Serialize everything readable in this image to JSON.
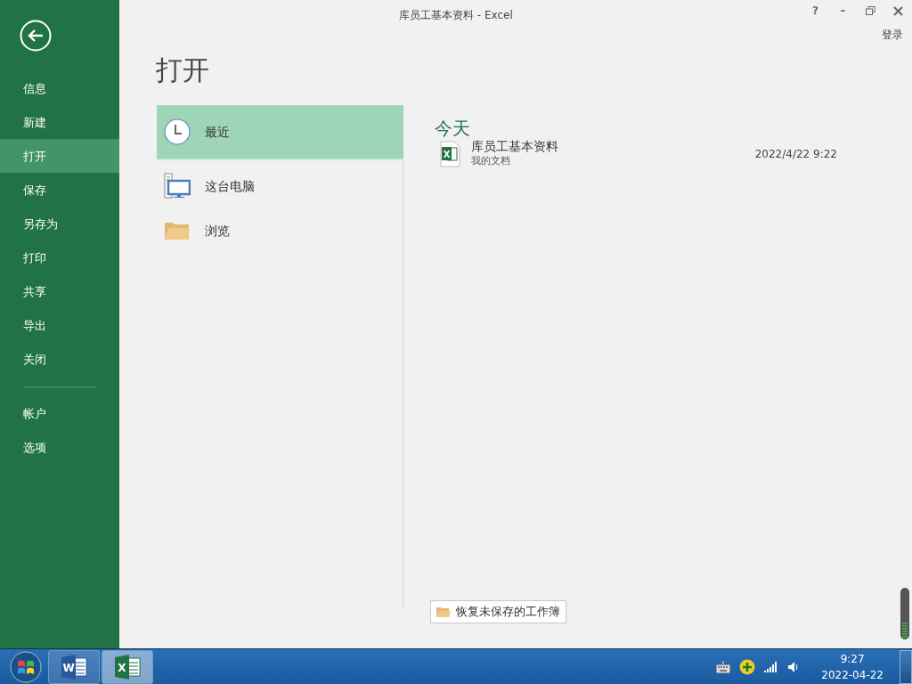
{
  "window": {
    "title": "库员工基本资料 - Excel",
    "controls": [
      "?",
      "–"
    ],
    "sign_in": "登录"
  },
  "sidebar": {
    "groups": [
      [
        {
          "label": "信息",
          "selected": false
        },
        {
          "label": "新建",
          "selected": false
        },
        {
          "label": "打开",
          "selected": true
        },
        {
          "label": "保存",
          "selected": false
        },
        {
          "label": "另存为",
          "selected": false
        },
        {
          "label": "打印",
          "selected": false
        },
        {
          "label": "共享",
          "selected": false
        },
        {
          "label": "导出",
          "selected": false
        },
        {
          "label": "关闭",
          "selected": false
        }
      ],
      [
        {
          "label": "帐户",
          "selected": false
        },
        {
          "label": "选项",
          "selected": false
        }
      ]
    ]
  },
  "page_title": "打开",
  "places": [
    {
      "kind": "recent",
      "label": "最近",
      "selected": true
    },
    {
      "kind": "computer",
      "label": "这台电脑",
      "selected": false
    },
    {
      "kind": "browse",
      "label": "浏览",
      "selected": false
    }
  ],
  "recent": {
    "group": "今天",
    "files": [
      {
        "name": "库员工基本资料",
        "location": "我的文档",
        "date": "2022/4/22 9:22",
        "icon_letter": "X"
      }
    ]
  },
  "recover_button": "恢复未保存的工作簿",
  "taskbar": {
    "apps": [
      {
        "kind": "word",
        "letter": "W",
        "selected": false
      },
      {
        "kind": "excel",
        "letter": "X",
        "selected": true
      }
    ],
    "time": "9:27",
    "date": "2022-04-22"
  }
}
